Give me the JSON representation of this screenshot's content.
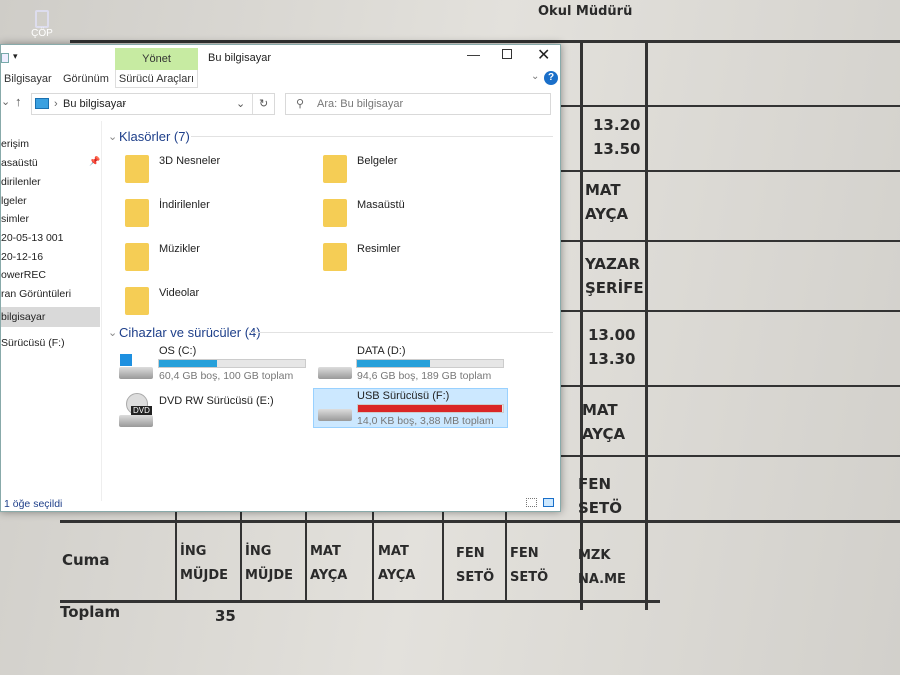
{
  "desktop": {
    "recycle_label": "ÇÖP"
  },
  "background": {
    "header": "Okul Müdürü",
    "times1": [
      "13.20",
      "13.50"
    ],
    "times2": [
      "13.00",
      "13.30"
    ],
    "cells": [
      "MAT",
      "AYÇA",
      "YAZAR",
      "ŞERİFE",
      "MAT",
      "AYÇA",
      "FEN",
      "SETÖ"
    ],
    "day": "Cuma",
    "row": [
      [
        "İNG",
        "MÜJDE"
      ],
      [
        "İNG",
        "MÜJDE"
      ],
      [
        "MAT",
        "AYÇA"
      ],
      [
        "MAT",
        "AYÇA"
      ],
      [
        "FEN",
        "SETÖ"
      ],
      [
        "FEN",
        "SETÖ"
      ],
      [
        "MZK",
        "NA.ME"
      ]
    ],
    "total_label": "Toplam",
    "total": "35"
  },
  "window": {
    "title": "Bu bilgisayar",
    "context_tab": "Yönet",
    "tabs": [
      "Bilgisayar",
      "Görünüm",
      "Sürücü Araçları"
    ],
    "address": "Bu bilgisayar",
    "search_placeholder": "Ara: Bu bilgisayar",
    "status": "1 öğe seçildi",
    "help": "?"
  },
  "nav": [
    "erişim",
    "asaüstü",
    "dirilenler",
    "lgeler",
    "simler",
    "20-05-13 001",
    "20-12-16",
    "owerREC",
    "ran Görüntüleri",
    "bilgisayar",
    "Sürücüsü (F:)"
  ],
  "folders_header": "Klasörler (7)",
  "folders": [
    "3D Nesneler",
    "Belgeler",
    "İndirilenler",
    "Masaüstü",
    "Müzikler",
    "Resimler",
    "Videolar"
  ],
  "drives_header": "Cihazlar ve sürücüler (4)",
  "drives": [
    {
      "name": "OS (C:)",
      "info": "60,4 GB boş, 100 GB toplam",
      "used_pct": 40,
      "color": "#26a0da"
    },
    {
      "name": "DATA (D:)",
      "info": "94,6 GB boş, 189 GB toplam",
      "used_pct": 50,
      "color": "#26a0da"
    },
    {
      "name": "DVD RW Sürücüsü (E:)"
    },
    {
      "name": "USB Sürücüsü (F:)",
      "info": "14,0 KB boş, 3,88 MB toplam",
      "used_pct": 99.6,
      "color": "#da2626"
    }
  ]
}
